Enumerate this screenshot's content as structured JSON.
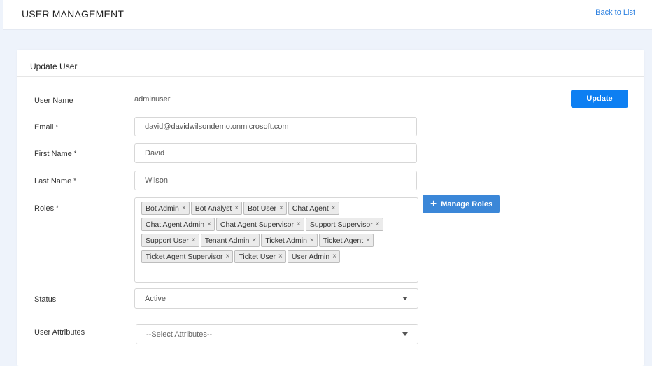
{
  "header": {
    "title": "USER MANAGEMENT",
    "back_link": "Back to List"
  },
  "card": {
    "title": "Update User",
    "update_button": "Update"
  },
  "form": {
    "username_label": "User Name",
    "username_value": "adminuser",
    "email_label": "Email",
    "email_value": "david@davidwilsondemo.onmicrosoft.com",
    "first_name_label": "First Name",
    "first_name_value": "David",
    "last_name_label": "Last Name",
    "last_name_value": "Wilson",
    "roles_label": "Roles",
    "required_mark": "*",
    "roles": [
      "Bot Admin",
      "Bot Analyst",
      "Bot User",
      "Chat Agent",
      "Chat Agent Admin",
      "Chat Agent Supervisor",
      "Support Supervisor",
      "Support User",
      "Tenant Admin",
      "Ticket Admin",
      "Ticket Agent",
      "Ticket Agent Supervisor",
      "Ticket User",
      "User Admin"
    ],
    "chip_remove": "×",
    "manage_roles_button": "Manage Roles",
    "manage_roles_icon": "+",
    "status_label": "Status",
    "status_value": "Active",
    "attributes_label": "User Attributes",
    "attributes_placeholder": "--Select Attributes--"
  },
  "colors": {
    "primary": "#0d7ff2",
    "manage_button": "#3b87d8",
    "background": "#eef3fb"
  }
}
